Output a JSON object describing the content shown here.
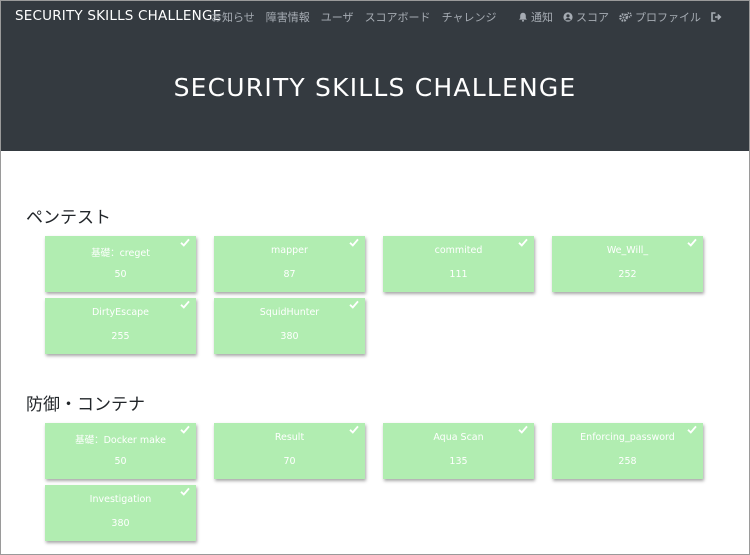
{
  "navbar": {
    "brand": "SECURITY SKILLS CHALLENGE",
    "links": [
      "お知らせ",
      "障害情報",
      "ユーザ",
      "スコアボード",
      "チャレンジ"
    ],
    "right": {
      "notify": "通知",
      "score": "スコア",
      "profile": "プロファイル"
    }
  },
  "hero": {
    "title": "SECURITY SKILLS CHALLENGE"
  },
  "sections": [
    {
      "title": "ペンテスト",
      "challenges": [
        {
          "name": "基礎：creget",
          "score": "50"
        },
        {
          "name": "mapper",
          "score": "87"
        },
        {
          "name": "commited",
          "score": "111"
        },
        {
          "name": "We_Will_",
          "score": "252"
        },
        {
          "name": "DirtyEscape",
          "score": "255"
        },
        {
          "name": "SquidHunter",
          "score": "380"
        }
      ]
    },
    {
      "title": "防御・コンテナ",
      "challenges": [
        {
          "name": "基礎：Docker make",
          "score": "50"
        },
        {
          "name": "Result",
          "score": "70"
        },
        {
          "name": "Aqua Scan",
          "score": "135"
        },
        {
          "name": "Enforcing_password",
          "score": "258"
        },
        {
          "name": "Investigation",
          "score": "380"
        }
      ]
    }
  ],
  "colors": {
    "header_bg": "#343a40",
    "card_bg": "#b1edb1",
    "nav_text": "#a6acb3"
  },
  "icons": {
    "solved": "check-icon",
    "notify": "bell-icon",
    "score": "user-circle-icon",
    "profile": "gears-icon",
    "logout": "sign-out-icon"
  }
}
